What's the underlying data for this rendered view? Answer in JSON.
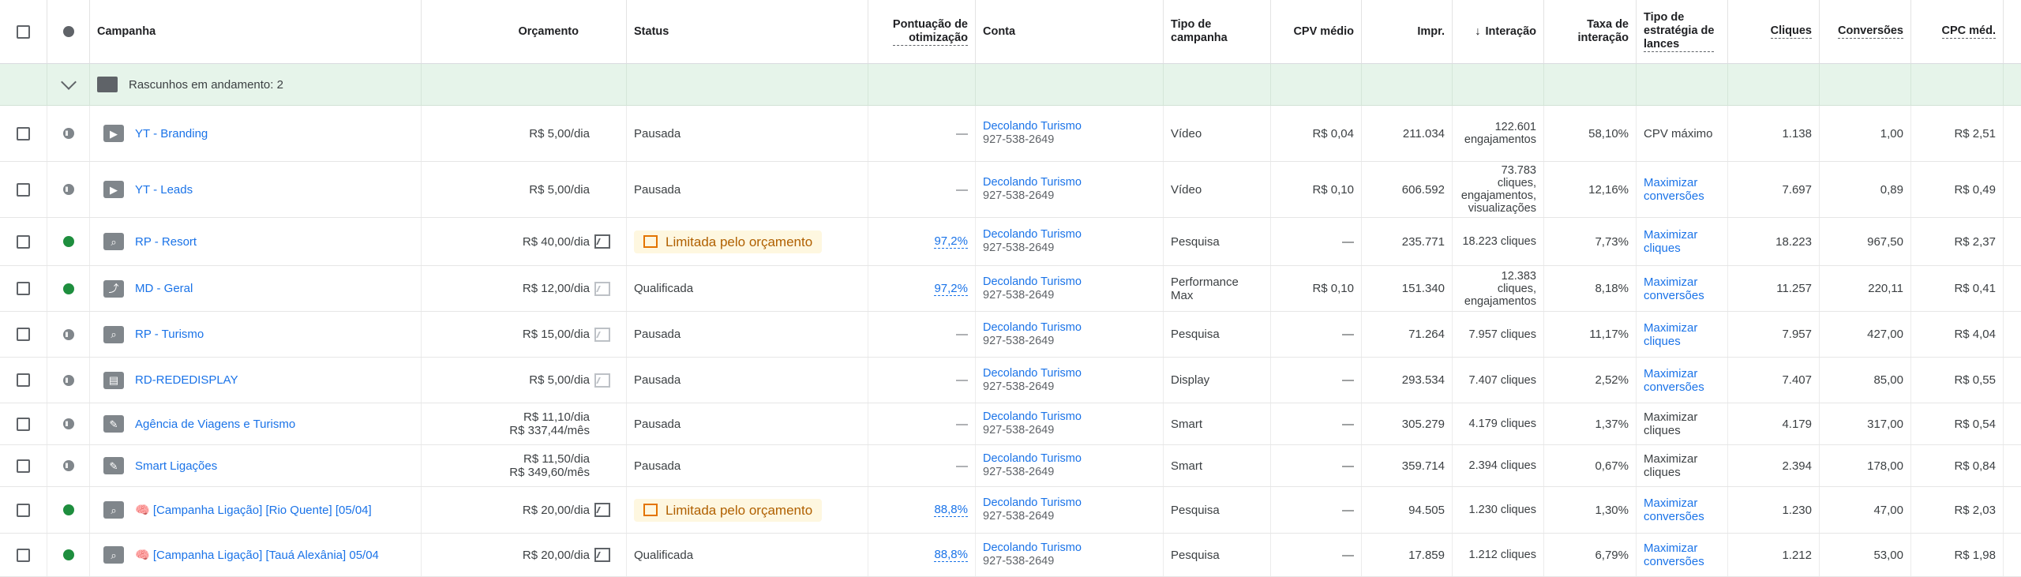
{
  "header": {
    "campaign": "Campanha",
    "budget": "Orçamento",
    "status": "Status",
    "opt_score_1": "Pontuação de",
    "opt_score_2": "otimização",
    "account": "Conta",
    "campaign_type_1": "Tipo de",
    "campaign_type_2": "campanha",
    "avg_cpv": "CPV médio",
    "impr": "Impr.",
    "interactions": "Interação",
    "interaction_rate_1": "Taxa de",
    "interaction_rate_2": "interação",
    "bid_strategy_1": "Tipo de",
    "bid_strategy_2": "estratégia de",
    "bid_strategy_3": "lances",
    "clicks": "Cliques",
    "conversions": "Conversões",
    "avg_cpc": "CPC méd."
  },
  "group": {
    "label": "Rascunhos em andamento: 2"
  },
  "rows": [
    {
      "name": "YT - Branding",
      "budget1": "R$ 5,00/dia",
      "budget2": "",
      "chart": "none",
      "status": "Pausada",
      "limited": false,
      "score": "—",
      "acct": "Decolando Turismo",
      "acct_id": "927-538-2649",
      "type": "Vídeo",
      "cpv": "R$ 0,04",
      "impr": "211.034",
      "inter": "122.601 engajamentos",
      "rate": "58,10%",
      "bid": "CPV máximo",
      "bid_link": false,
      "clicks": "1.138",
      "conv": "1,00",
      "cpc": "R$ 2,51",
      "enabled": false,
      "icon": "video-icon",
      "glyph": "▶",
      "h": 70
    },
    {
      "name": "YT - Leads",
      "budget1": "R$ 5,00/dia",
      "budget2": "",
      "chart": "none",
      "status": "Pausada",
      "limited": false,
      "score": "—",
      "acct": "Decolando Turismo",
      "acct_id": "927-538-2649",
      "type": "Vídeo",
      "cpv": "R$ 0,10",
      "impr": "606.592",
      "inter": "73.783 cliques, engajamentos, visualizações",
      "rate": "12,16%",
      "bid": "Maximizar conversões",
      "bid_link": true,
      "clicks": "7.697",
      "conv": "0,89",
      "cpc": "R$ 0,49",
      "enabled": false,
      "icon": "video-icon",
      "glyph": "▶",
      "h": 70
    },
    {
      "name": "RP - Resort",
      "budget1": "R$ 40,00/dia",
      "budget2": "",
      "chart": "on",
      "status": "Limitada pelo orçamento",
      "limited": true,
      "score": "97,2%",
      "acct": "Decolando Turismo",
      "acct_id": "927-538-2649",
      "type": "Pesquisa",
      "cpv": "—",
      "impr": "235.771",
      "inter": "18.223 cliques",
      "rate": "7,73%",
      "bid": "Maximizar cliques",
      "bid_link": true,
      "clicks": "18.223",
      "conv": "967,50",
      "cpc": "R$ 2,37",
      "enabled": true,
      "icon": "search-icon",
      "glyph": "⌕",
      "h": 60
    },
    {
      "name": "MD - Geral",
      "budget1": "R$ 12,00/dia",
      "budget2": "",
      "chart": "off",
      "status": "Qualificada",
      "limited": false,
      "score": "97,2%",
      "acct": "Decolando Turismo",
      "acct_id": "927-538-2649",
      "type": "Performance Max",
      "cpv": "R$ 0,10",
      "impr": "151.340",
      "inter": "12.383 cliques, engajamentos",
      "rate": "8,18%",
      "bid": "Maximizar conversões",
      "bid_link": true,
      "clicks": "11.257",
      "conv": "220,11",
      "cpc": "R$ 0,41",
      "enabled": true,
      "icon": "performance-max-icon",
      "glyph": "⤴",
      "h": 57
    },
    {
      "name": "RP - Turismo",
      "budget1": "R$ 15,00/dia",
      "budget2": "",
      "chart": "off",
      "status": "Pausada",
      "limited": false,
      "score": "—",
      "acct": "Decolando Turismo",
      "acct_id": "927-538-2649",
      "type": "Pesquisa",
      "cpv": "—",
      "impr": "71.264",
      "inter": "7.957 cliques",
      "rate": "11,17%",
      "bid": "Maximizar cliques",
      "bid_link": true,
      "clicks": "7.957",
      "conv": "427,00",
      "cpc": "R$ 4,04",
      "enabled": false,
      "icon": "search-icon",
      "glyph": "⌕",
      "h": 57
    },
    {
      "name": "RD-REDEDISPLAY",
      "budget1": "R$ 5,00/dia",
      "budget2": "",
      "chart": "off",
      "status": "Pausada",
      "limited": false,
      "score": "—",
      "acct": "Decolando Turismo",
      "acct_id": "927-538-2649",
      "type": "Display",
      "cpv": "—",
      "impr": "293.534",
      "inter": "7.407 cliques",
      "rate": "2,52%",
      "bid": "Maximizar conversões",
      "bid_link": true,
      "clicks": "7.407",
      "conv": "85,00",
      "cpc": "R$ 0,55",
      "enabled": false,
      "icon": "display-icon",
      "glyph": "▤",
      "h": 57
    },
    {
      "name": "Agência de Viagens e Turismo",
      "budget1": "R$ 11,10/dia",
      "budget2": "R$ 337,44/mês",
      "chart": "none",
      "status": "Pausada",
      "limited": false,
      "score": "—",
      "acct": "Decolando Turismo",
      "acct_id": "927-538-2649",
      "type": "Smart",
      "cpv": "—",
      "impr": "305.279",
      "inter": "4.179 cliques",
      "rate": "1,37%",
      "bid": "Maximizar cliques",
      "bid_link": false,
      "clicks": "4.179",
      "conv": "317,00",
      "cpc": "R$ 0,54",
      "enabled": false,
      "icon": "smart-campaign-icon",
      "glyph": "✎",
      "h": 52
    },
    {
      "name": "Smart Ligações",
      "budget1": "R$ 11,50/dia",
      "budget2": "R$ 349,60/mês",
      "chart": "none",
      "status": "Pausada",
      "limited": false,
      "score": "—",
      "acct": "Decolando Turismo",
      "acct_id": "927-538-2649",
      "type": "Smart",
      "cpv": "—",
      "impr": "359.714",
      "inter": "2.394 cliques",
      "rate": "0,67%",
      "bid": "Maximizar cliques",
      "bid_link": false,
      "clicks": "2.394",
      "conv": "178,00",
      "cpc": "R$ 0,84",
      "enabled": false,
      "icon": "smart-campaign-icon",
      "glyph": "✎",
      "h": 52
    },
    {
      "name": "🧠 [Campanha Ligação] [Rio Quente] [05/04]",
      "budget1": "R$ 20,00/dia",
      "budget2": "",
      "chart": "on",
      "status": "Limitada pelo orçamento",
      "limited": true,
      "score": "88,8%",
      "acct": "Decolando Turismo",
      "acct_id": "927-538-2649",
      "type": "Pesquisa",
      "cpv": "—",
      "impr": "94.505",
      "inter": "1.230 cliques",
      "rate": "1,30%",
      "bid": "Maximizar conversões",
      "bid_link": true,
      "clicks": "1.230",
      "conv": "47,00",
      "cpc": "R$ 2,03",
      "enabled": true,
      "icon": "search-icon",
      "glyph": "⌕",
      "h": 58
    },
    {
      "name": "🧠 [Campanha Ligação] [Tauá Alexânia] 05/04",
      "budget1": "R$ 20,00/dia",
      "budget2": "",
      "chart": "on",
      "status": "Qualificada",
      "limited": false,
      "score": "88,8%",
      "acct": "Decolando Turismo",
      "acct_id": "927-538-2649",
      "type": "Pesquisa",
      "cpv": "—",
      "impr": "17.859",
      "inter": "1.212 cliques",
      "rate": "6,79%",
      "bid": "Maximizar conversões",
      "bid_link": true,
      "clicks": "1.212",
      "conv": "53,00",
      "cpc": "R$ 1,98",
      "enabled": true,
      "icon": "search-icon",
      "glyph": "⌕",
      "h": 54
    }
  ]
}
